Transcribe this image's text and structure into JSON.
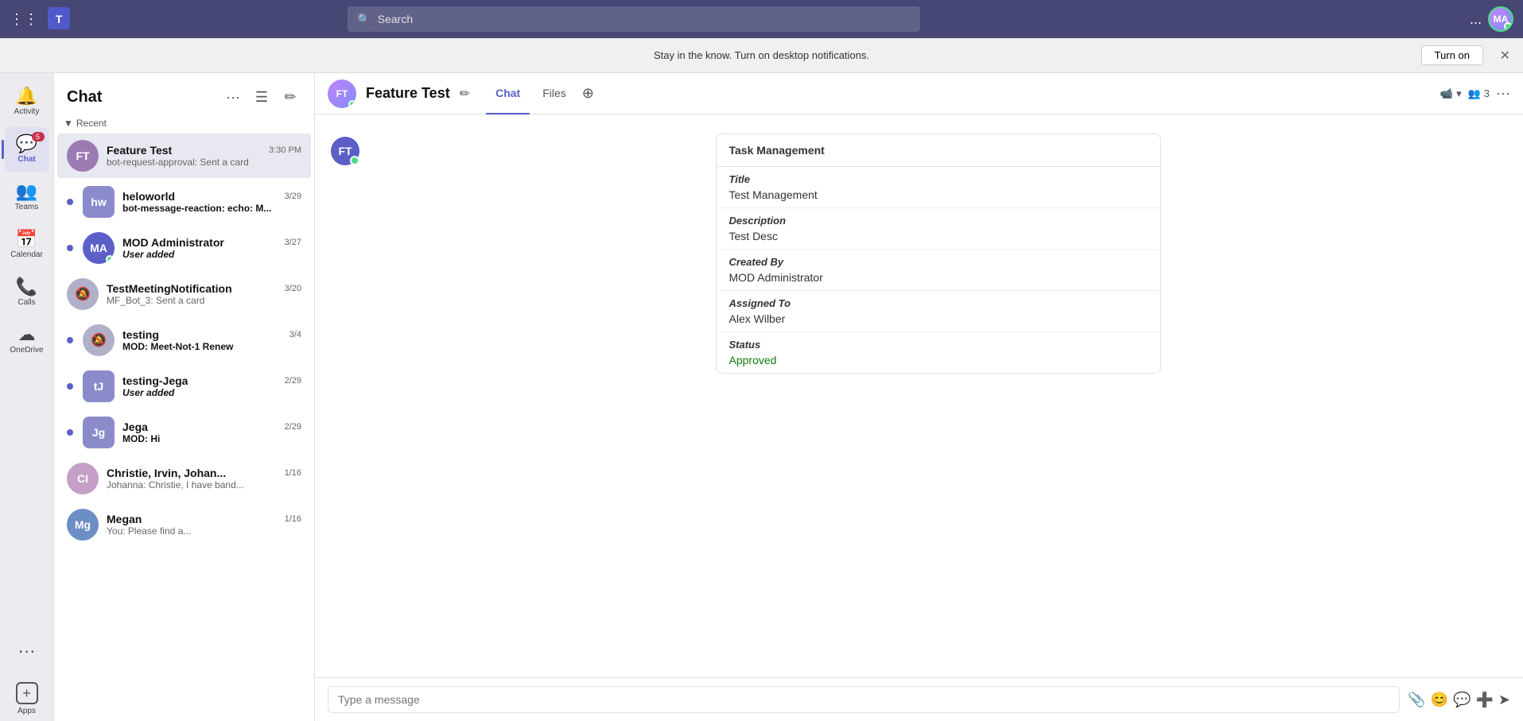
{
  "topbar": {
    "search_placeholder": "Search",
    "more_label": "...",
    "notification_text": "Stay in the know. Turn on desktop notifications.",
    "turn_on_label": "Turn on"
  },
  "sidebar": {
    "items": [
      {
        "id": "activity",
        "label": "Activity",
        "icon": "🔔",
        "badge": null
      },
      {
        "id": "chat",
        "label": "Chat",
        "icon": "💬",
        "badge": "5",
        "active": true
      },
      {
        "id": "teams",
        "label": "Teams",
        "icon": "👥",
        "badge": null
      },
      {
        "id": "calendar",
        "label": "Calendar",
        "icon": "📅",
        "badge": null
      },
      {
        "id": "calls",
        "label": "Calls",
        "icon": "📞",
        "badge": null
      },
      {
        "id": "onedrive",
        "label": "OneDrive",
        "icon": "☁",
        "badge": null
      }
    ],
    "more_label": "...",
    "apps_label": "Apps"
  },
  "chat_panel": {
    "title": "Chat",
    "section_label": "Recent",
    "items": [
      {
        "id": "feature-test",
        "name": "Feature Test",
        "time": "3:30 PM",
        "preview": "bot-request-approval: Sent a card",
        "unread": false,
        "avatar_type": "person",
        "avatar_color": "#9c7bb5"
      },
      {
        "id": "heloworld",
        "name": "heloworld",
        "time": "3/29",
        "preview": "bot-message-reaction: echo: M...",
        "unread": true,
        "avatar_type": "group",
        "avatar_color": "#8b8bcc"
      },
      {
        "id": "mod-administrator",
        "name": "MOD Administrator",
        "time": "3/27",
        "preview": "User added",
        "preview_bold": true,
        "unread": true,
        "avatar_type": "person",
        "avatar_color": "#5b5fc7"
      },
      {
        "id": "testmeeting",
        "name": "TestMeetingNotification",
        "time": "3/20",
        "preview": "MF_Bot_3: Sent a card",
        "unread": false,
        "avatar_type": "notif-off",
        "avatar_color": "#b0b0c8"
      },
      {
        "id": "testing",
        "name": "testing",
        "time": "3/4",
        "preview": "MOD: Meet-Not-1 Renew",
        "unread": true,
        "avatar_type": "notif-off",
        "avatar_color": "#b0b0c8"
      },
      {
        "id": "testing-jega",
        "name": "testing-Jega",
        "time": "2/29",
        "preview": "User added",
        "preview_italic": true,
        "unread": true,
        "avatar_type": "group",
        "avatar_color": "#8b8bcc"
      },
      {
        "id": "jega",
        "name": "Jega",
        "time": "2/29",
        "preview": "MOD: Hi",
        "unread": true,
        "avatar_type": "group",
        "avatar_color": "#8b8bcc"
      },
      {
        "id": "christie",
        "name": "Christie, Irvin, Johan...",
        "time": "1/16",
        "preview": "Johanna: Christie, I have band...",
        "unread": false,
        "avatar_type": "person",
        "avatar_color": "#c4a0c8"
      },
      {
        "id": "megan",
        "name": "Megan",
        "time": "1/16",
        "preview": "You: Please find a...",
        "unread": false,
        "avatar_type": "person",
        "avatar_color": "#6b8ec4"
      }
    ]
  },
  "channel": {
    "name": "Feature Test",
    "tabs": [
      {
        "id": "chat",
        "label": "Chat",
        "active": true
      },
      {
        "id": "files",
        "label": "Files",
        "active": false
      }
    ],
    "participants_count": "3"
  },
  "task_card": {
    "header": "Task Management",
    "fields": [
      {
        "label": "Title",
        "value": "Test Management",
        "style": "normal"
      },
      {
        "label": "Description",
        "value": "Test Desc",
        "style": "normal"
      },
      {
        "label": "Created By",
        "value": "MOD Administrator",
        "style": "normal"
      },
      {
        "label": "Assigned To",
        "value": "Alex Wilber",
        "style": "normal"
      },
      {
        "label": "Status",
        "value": "Approved",
        "style": "green"
      }
    ]
  },
  "message_input": {
    "placeholder": "Type a message"
  }
}
